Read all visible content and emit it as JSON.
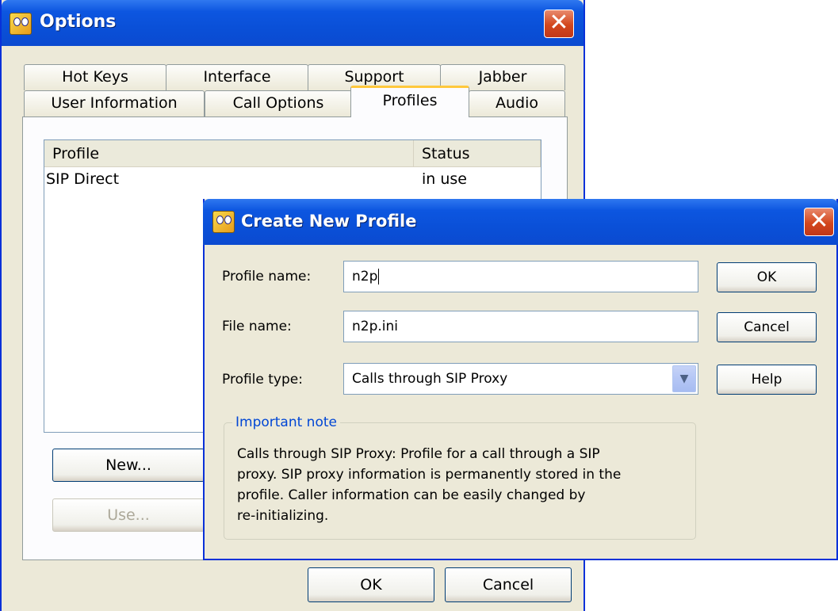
{
  "options_window": {
    "title": "Options",
    "close_glyph": "✕",
    "tabs_row1": [
      "Hot Keys",
      "Interface",
      "Support",
      "Jabber"
    ],
    "tabs_row2": [
      "User Information",
      "Call Options",
      "Profiles",
      "Audio"
    ],
    "active_tab": "Profiles",
    "profile_list": {
      "columns": [
        "Profile",
        "Status"
      ],
      "rows": [
        {
          "profile": "SIP Direct",
          "status": "in use"
        }
      ]
    },
    "new_button": "New...",
    "use_button": "Use...",
    "ok_button": "OK",
    "cancel_button": "Cancel"
  },
  "dialog": {
    "title": "Create New Profile",
    "close_glyph": "✕",
    "profile_name_label": "Profile name:",
    "profile_name_value": "n2p",
    "file_name_label": "File name:",
    "file_name_value": "n2p.ini",
    "profile_type_label": "Profile type:",
    "profile_type_value": "Calls through SIP Proxy",
    "ok_button": "OK",
    "cancel_button": "Cancel",
    "help_button": "Help",
    "note_title": "Important note",
    "note_text": "Calls through SIP Proxy: Profile for a call through a SIP\nproxy. SIP proxy information is permanently stored in the\nprofile. Caller information can be easily changed by\nre-initializing."
  },
  "icons": {
    "app": "app-face-icon",
    "close": "close-icon",
    "dropdown": "chevron-down-icon"
  },
  "colors": {
    "titlebar": "#0a50d8",
    "window_bg": "#ece9d8",
    "close_button": "#d3471d",
    "active_tab_accent": "#ffc83c",
    "group_title": "#0046d5"
  }
}
